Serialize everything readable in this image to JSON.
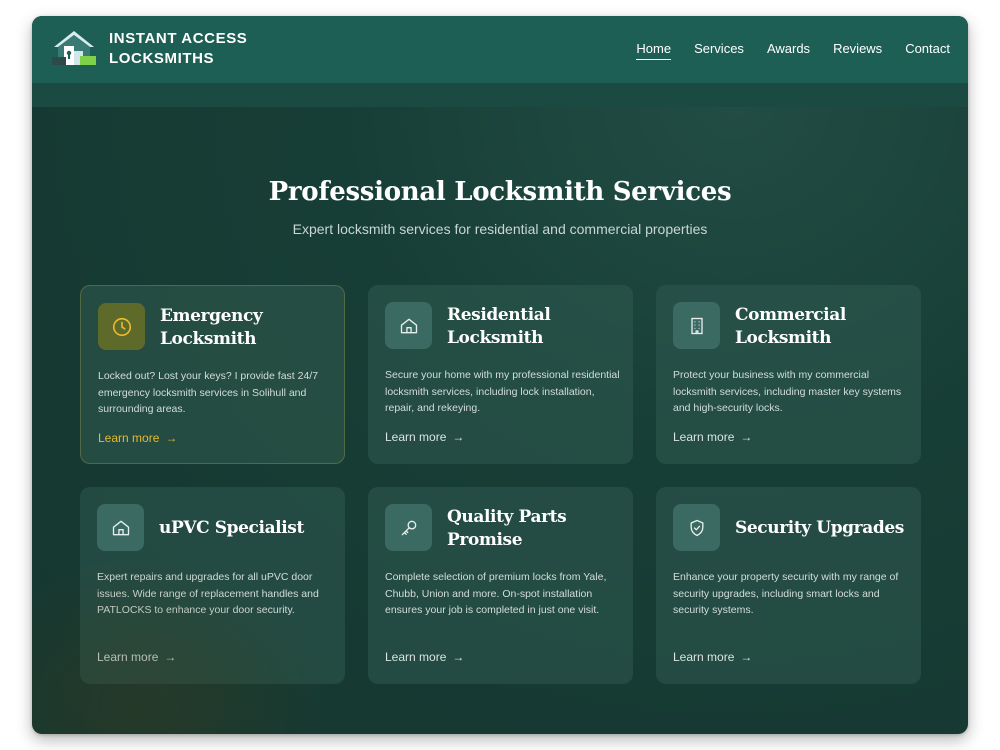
{
  "brand": {
    "name_line1": "INSTANT ACCESS",
    "name_line2": "LOCKSMITHS",
    "logo_icon": "house-keyhole-logo-icon"
  },
  "nav": {
    "items": [
      {
        "label": "Home",
        "active": true
      },
      {
        "label": "Services",
        "active": false
      },
      {
        "label": "Awards",
        "active": false
      },
      {
        "label": "Reviews",
        "active": false
      },
      {
        "label": "Contact",
        "active": false
      }
    ]
  },
  "hero": {
    "title": "Professional Locksmith Services",
    "subtitle": "Expert locksmith services for residential and commercial properties"
  },
  "cards": [
    {
      "icon": "clock-icon",
      "title": "Emergency Locksmith",
      "description": "Locked out? Lost your keys? I provide fast 24/7 emergency locksmith services in Solihull and surrounding areas.",
      "link": "Learn more",
      "highlighted": true
    },
    {
      "icon": "house-icon",
      "title": "Residential Locksmith",
      "description": "Secure your home with my professional residential locksmith services, including lock installation, repair, and rekeying.",
      "link": "Learn more",
      "highlighted": false
    },
    {
      "icon": "building-icon",
      "title": "Commercial Locksmith",
      "description": "Protect your business with my commercial locksmith services, including master key systems and high-security locks.",
      "link": "Learn more",
      "highlighted": false
    },
    {
      "icon": "house-icon",
      "title": "uPVC Specialist",
      "description": "Expert repairs and upgrades for all uPVC door issues. Wide range of replacement handles and PATLOCKS to enhance your door security.",
      "link": "Learn more",
      "highlighted": false
    },
    {
      "icon": "key-icon",
      "title": "Quality Parts Promise",
      "description": "Complete selection of premium locks from Yale, Chubb, Union and more. On-spot installation ensures your job is completed in just one visit.",
      "link": "Learn more",
      "highlighted": false
    },
    {
      "icon": "shield-check-icon",
      "title": "Security Upgrades",
      "description": "Enhance your property security with my range of security upgrades, including smart locks and security systems.",
      "link": "Learn more",
      "highlighted": false
    }
  ],
  "colors": {
    "nav_bg": "#1e5f55",
    "page_bg": "#173e36",
    "accent_yellow": "#e8b92c"
  }
}
